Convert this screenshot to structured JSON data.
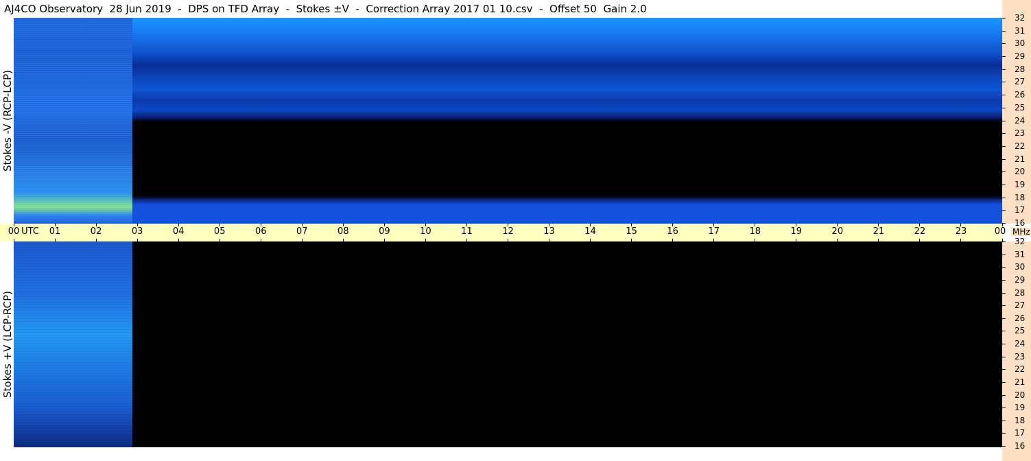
{
  "title": "AJ4CO Observatory  28 Jun 2019  -  DPS on TFD Array  -  Stokes ±V  -  Correction Array 2017 01 10.csv  -  Offset 50  Gain 2.0",
  "chart_data": {
    "type": "heatmap",
    "title": "AJ4CO Observatory  28 Jun 2019  -  DPS on TFD Array  -  Stokes ±V  -  Correction Array 2017 01 10.csv  -  Offset 50  Gain 2.0",
    "panels": [
      {
        "ylabel": "Stokes -V (RCP-LCP)"
      },
      {
        "ylabel": "Stokes +V (LCP-RCP)"
      }
    ],
    "x_ticks": [
      "00",
      "01",
      "02",
      "03",
      "04",
      "05",
      "06",
      "07",
      "08",
      "09",
      "10",
      "11",
      "12",
      "13",
      "14",
      "15",
      "16",
      "17",
      "18",
      "19",
      "20",
      "21",
      "22",
      "23",
      "00"
    ],
    "x_unit": "UTC",
    "y_ticks": [
      32,
      31,
      30,
      29,
      28,
      27,
      26,
      25,
      24,
      23,
      22,
      21,
      20,
      19,
      18,
      17,
      16
    ],
    "y_unit": "MHz",
    "xlim": [
      0,
      24
    ],
    "ylim": [
      16,
      32
    ],
    "data_extent_hours": 2.88,
    "colors": {
      "time_axis_bg": "#ffffc0",
      "freq_axis_bg": "#ffe0c4"
    }
  }
}
